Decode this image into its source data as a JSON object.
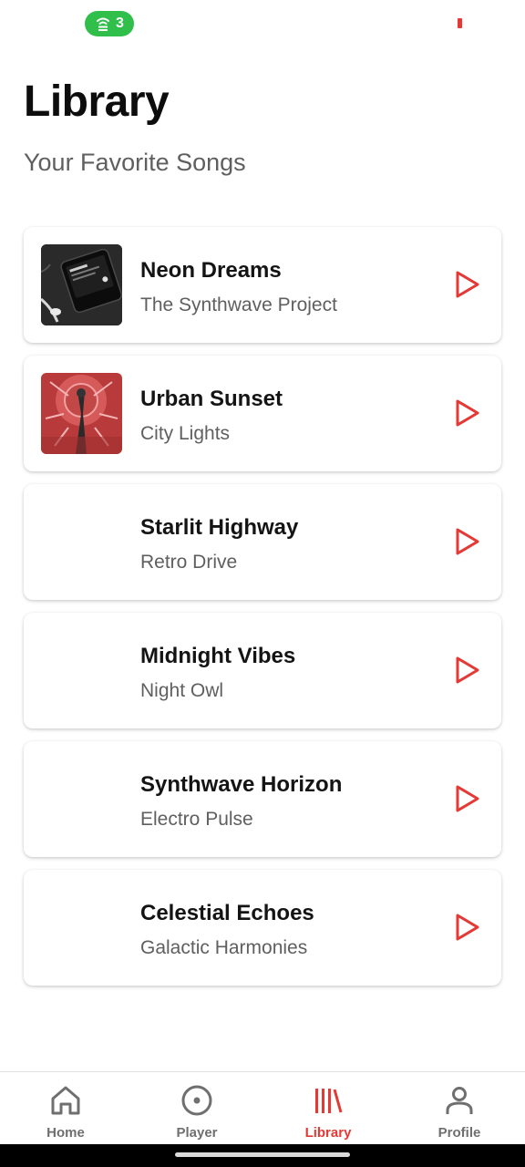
{
  "status_bar": {
    "hotspot_count": "3"
  },
  "header": {
    "title": "Library",
    "subtitle": "Your Favorite Songs"
  },
  "songs": [
    {
      "title": "Neon Dreams",
      "artist": "The Synthwave Project",
      "has_art": true
    },
    {
      "title": "Urban Sunset",
      "artist": "City Lights",
      "has_art": true
    },
    {
      "title": "Starlit Highway",
      "artist": "Retro Drive",
      "has_art": false
    },
    {
      "title": "Midnight Vibes",
      "artist": "Night Owl",
      "has_art": false
    },
    {
      "title": "Synthwave Horizon",
      "artist": "Electro Pulse",
      "has_art": false
    },
    {
      "title": "Celestial Echoes",
      "artist": "Galactic Harmonies",
      "has_art": false
    }
  ],
  "bottom_nav": {
    "items": [
      {
        "label": "Home",
        "icon": "home-icon",
        "active": false
      },
      {
        "label": "Player",
        "icon": "disc-icon",
        "active": false
      },
      {
        "label": "Library",
        "icon": "library-icon",
        "active": true
      },
      {
        "label": "Profile",
        "icon": "person-icon",
        "active": false
      }
    ]
  },
  "colors": {
    "accent": "#e53935",
    "hotspot": "#2fbf4a",
    "text_primary": "#141414",
    "text_secondary": "#5f5f5f",
    "nav_inactive": "#6f6f6f"
  }
}
